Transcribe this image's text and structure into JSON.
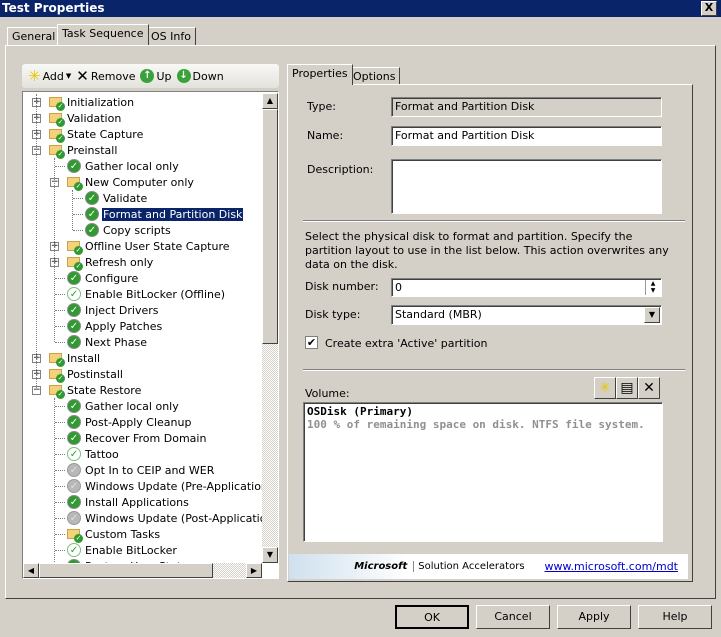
{
  "window": {
    "title": "Test Properties",
    "close": "X"
  },
  "tabs": [
    "General",
    "Task Sequence",
    "OS Info"
  ],
  "toolbar": {
    "add": "Add",
    "remove": "Remove",
    "up": "Up",
    "down": "Down"
  },
  "tree": [
    {
      "label": "Initialization",
      "level": 0,
      "icon": "folder",
      "expander": "+"
    },
    {
      "label": "Validation",
      "level": 0,
      "icon": "folder",
      "expander": "+"
    },
    {
      "label": "State Capture",
      "level": 0,
      "icon": "folder",
      "expander": "+"
    },
    {
      "label": "Preinstall",
      "level": 0,
      "icon": "folder",
      "expander": "-"
    },
    {
      "label": "Gather local only",
      "level": 1,
      "icon": "check"
    },
    {
      "label": "New Computer only",
      "level": 1,
      "icon": "folder",
      "expander": "-"
    },
    {
      "label": "Validate",
      "level": 2,
      "icon": "check"
    },
    {
      "label": "Format and Partition Disk",
      "level": 2,
      "icon": "check",
      "selected": true
    },
    {
      "label": "Copy scripts",
      "level": 2,
      "icon": "check"
    },
    {
      "label": "Offline User State Capture",
      "level": 1,
      "icon": "folder",
      "expander": "+"
    },
    {
      "label": "Refresh only",
      "level": 1,
      "icon": "folder",
      "expander": "+"
    },
    {
      "label": "Configure",
      "level": 1,
      "icon": "check"
    },
    {
      "label": "Enable BitLocker (Offline)",
      "level": 1,
      "icon": "check-light"
    },
    {
      "label": "Inject Drivers",
      "level": 1,
      "icon": "check"
    },
    {
      "label": "Apply Patches",
      "level": 1,
      "icon": "check"
    },
    {
      "label": "Next Phase",
      "level": 1,
      "icon": "check"
    },
    {
      "label": "Install",
      "level": 0,
      "icon": "folder",
      "expander": "+"
    },
    {
      "label": "Postinstall",
      "level": 0,
      "icon": "folder",
      "expander": "+"
    },
    {
      "label": "State Restore",
      "level": 0,
      "icon": "folder",
      "expander": "-"
    },
    {
      "label": "Gather local only",
      "level": 1,
      "icon": "check"
    },
    {
      "label": "Post-Apply Cleanup",
      "level": 1,
      "icon": "check"
    },
    {
      "label": "Recover From Domain",
      "level": 1,
      "icon": "check"
    },
    {
      "label": "Tattoo",
      "level": 1,
      "icon": "check-light"
    },
    {
      "label": "Opt In to CEIP and WER",
      "level": 1,
      "icon": "disabled"
    },
    {
      "label": "Windows Update (Pre-Application Inst",
      "level": 1,
      "icon": "disabled"
    },
    {
      "label": "Install Applications",
      "level": 1,
      "icon": "check"
    },
    {
      "label": "Windows Update (Post-Application Ins",
      "level": 1,
      "icon": "disabled"
    },
    {
      "label": "Custom Tasks",
      "level": 1,
      "icon": "folder"
    },
    {
      "label": "Enable BitLocker",
      "level": 1,
      "icon": "check-light"
    },
    {
      "label": "Restore User State",
      "level": 1,
      "icon": "check"
    }
  ],
  "inner_tabs": [
    "Properties",
    "Options"
  ],
  "props": {
    "type_label": "Type:",
    "type_value": "Format and Partition Disk",
    "name_label": "Name:",
    "name_value": "Format and Partition Disk",
    "description_label": "Description:",
    "description_value": "",
    "instructions": "Select the physical disk to format and partition.  Specify the partition layout to use in the list below. This action overwrites any data on the disk.",
    "disk_number_label": "Disk number:",
    "disk_number_value": "0",
    "disk_type_label": "Disk type:",
    "disk_type_value": "Standard (MBR)",
    "extra_active_label": "Create extra 'Active' partition",
    "extra_active_checked": true,
    "volume_label": "Volume:",
    "volumes": [
      {
        "name": "OSDisk (Primary)",
        "detail": "100 % of remaining space on disk. NTFS file system."
      }
    ]
  },
  "banner": {
    "brand": "Microsoft",
    "product": "Solution Accelerators",
    "link": "www.microsoft.com/mdt"
  },
  "buttons": {
    "ok": "OK",
    "cancel": "Cancel",
    "apply": "Apply",
    "help": "Help"
  }
}
